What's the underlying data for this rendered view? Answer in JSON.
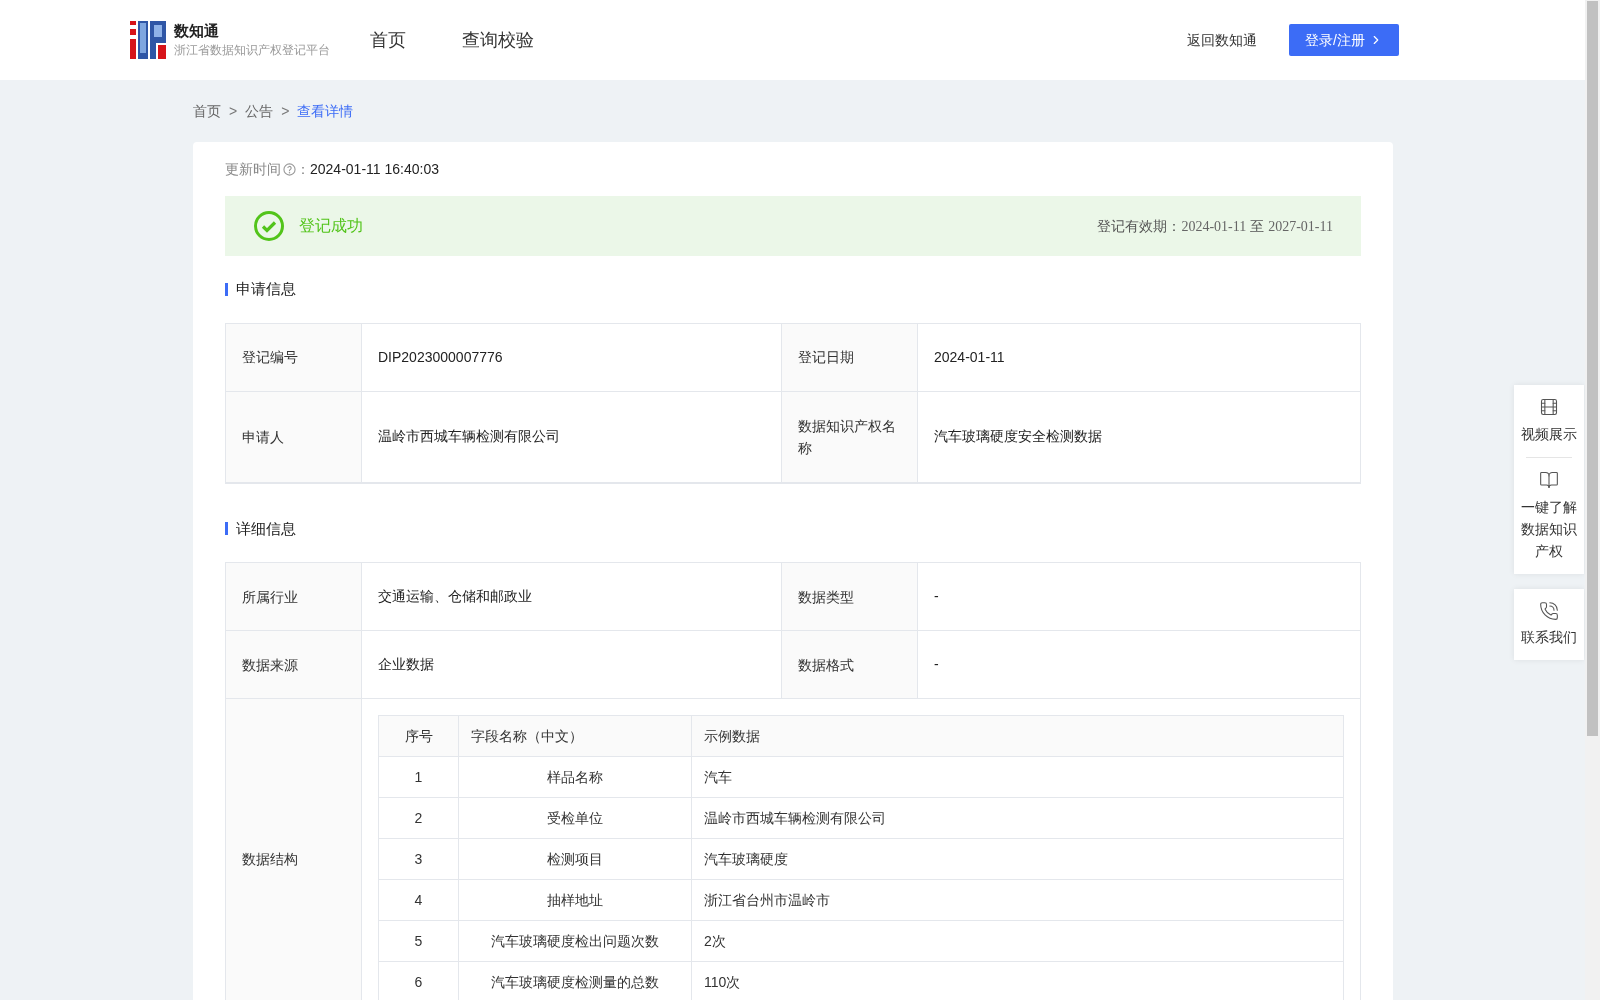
{
  "header": {
    "logo_title": "数知通",
    "logo_subtitle": "浙江省数据知识产权登记平台",
    "nav": [
      {
        "label": "首页"
      },
      {
        "label": "查询校验"
      }
    ],
    "back_link": "返回数知通",
    "login_button": "登录/注册"
  },
  "breadcrumb": [
    {
      "label": "首页",
      "selected": false
    },
    {
      "label": "公告",
      "selected": false
    },
    {
      "label": "查看详情",
      "selected": true
    }
  ],
  "breadcrumb_separator": ">",
  "update": {
    "label": "更新时间",
    "colon": "：",
    "value": "2024-01-11 16:40:03"
  },
  "status": {
    "text": "登记成功",
    "validity_label": "登记有效期：",
    "validity_start": "2024-01-11",
    "validity_sep": "至",
    "validity_end": "2027-01-11"
  },
  "application_section": {
    "title": "申请信息",
    "rows": [
      [
        {
          "label": "登记编号",
          "value": "DIP2023000007776"
        },
        {
          "label": "登记日期",
          "value": "2024-01-11"
        }
      ],
      [
        {
          "label": "申请人",
          "value": "温岭市西城车辆检测有限公司"
        },
        {
          "label": "数据知识产权名称",
          "value": "汽车玻璃硬度安全检测数据"
        }
      ]
    ]
  },
  "detail_section": {
    "title": "详细信息",
    "rows": [
      [
        {
          "label": "所属行业",
          "value": "交通运输、仓储和邮政业"
        },
        {
          "label": "数据类型",
          "value": "-"
        }
      ],
      [
        {
          "label": "数据来源",
          "value": "企业数据"
        },
        {
          "label": "数据格式",
          "value": "-"
        }
      ]
    ],
    "structure": {
      "label": "数据结构",
      "columns": [
        "序号",
        "字段名称（中文）",
        "示例数据"
      ],
      "rows": [
        [
          "1",
          "样品名称",
          "汽车"
        ],
        [
          "2",
          "受检单位",
          "温岭市西城车辆检测有限公司"
        ],
        [
          "3",
          "检测项目",
          "汽车玻璃硬度"
        ],
        [
          "4",
          "抽样地址",
          "浙江省台州市温岭市"
        ],
        [
          "5",
          "汽车玻璃硬度检出问题次数",
          "2次"
        ],
        [
          "6",
          "汽车玻璃硬度检测量的总数",
          "110次"
        ]
      ]
    }
  },
  "side_panel": [
    {
      "kind": "video",
      "label": "视频展示"
    },
    {
      "kind": "book",
      "label": "一键了解数据知识产权"
    },
    {
      "kind": "phone",
      "label": "联系我们"
    }
  ]
}
